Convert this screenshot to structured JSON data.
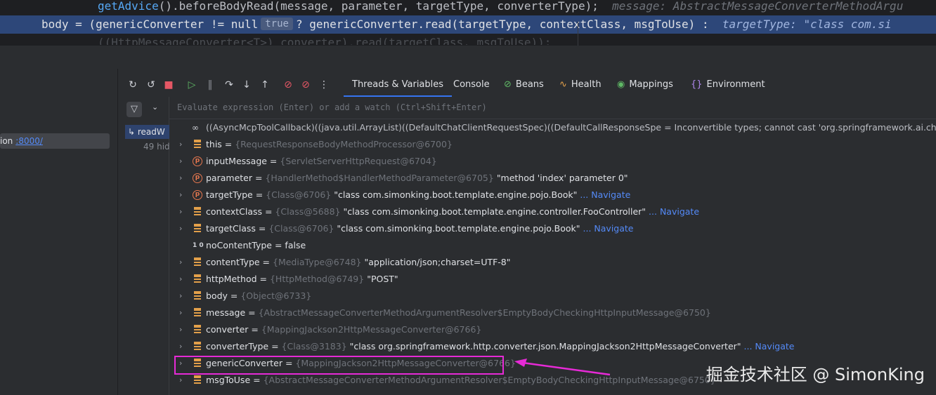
{
  "editor": {
    "line1": {
      "code_fn": "getAdvice",
      "code_rest": "().beforeBodyRead(message, parameter, targetType, converterType);",
      "hint": "message: AbstractMessageConverterMethodArgu"
    },
    "line2": {
      "code_a": "body = (genericConverter != null",
      "inline_value": "true",
      "code_b": "? genericConverter.read(targetType, contextClass, msgToUse) :",
      "hint": "targetType: \"class com.si"
    },
    "line3": {
      "code": "((HttpMessageConverter<T>) converter).read(targetClass, msgToUse));"
    }
  },
  "services": {
    "item_prefix": "ion",
    "item_port": ":8000/"
  },
  "toolbar": {
    "tabs": [
      {
        "label": "Threads & Variables",
        "active": true
      },
      {
        "label": "Console",
        "active": false
      },
      {
        "label": "Beans",
        "icon": "beans-icon",
        "active": false
      },
      {
        "label": "Health",
        "icon": "health-icon",
        "active": false
      },
      {
        "label": "Mappings",
        "icon": "mappings-icon",
        "active": false
      },
      {
        "label": "Environment",
        "icon": "environment-icon",
        "active": false
      }
    ]
  },
  "frames": {
    "current": "readW",
    "hidden": "49 hid"
  },
  "eval": {
    "placeholder": "Evaluate expression (Enter) or add a watch (Ctrl+Shift+Enter)"
  },
  "variables": [
    {
      "kind": "watch",
      "expandable": false,
      "name": "",
      "text": "((AsyncMcpToolCallback)((java.util.ArrayList)((DefaultChatClientRequestSpec)((DefaultCallResponseSpe = Inconvertible types; cannot cast 'org.springframework.ai.chat.client.ChatCli"
    },
    {
      "kind": "field",
      "expandable": true,
      "name": "this",
      "type": "{RequestResponseBodyMethodProcessor@6700}",
      "value": "",
      "navigate": ""
    },
    {
      "kind": "param",
      "expandable": true,
      "name": "inputMessage",
      "type": "{ServletServerHttpRequest@6704}",
      "value": "",
      "navigate": ""
    },
    {
      "kind": "param",
      "expandable": true,
      "name": "parameter",
      "type": "{HandlerMethod$HandlerMethodParameter@6705}",
      "value": "\"method 'index' parameter 0\"",
      "navigate": ""
    },
    {
      "kind": "param",
      "expandable": true,
      "name": "targetType",
      "type": "{Class@6706}",
      "value": "\"class com.simonking.boot.template.engine.pojo.Book\"",
      "navigate": "... Navigate"
    },
    {
      "kind": "field",
      "expandable": true,
      "name": "contextClass",
      "type": "{Class@5688}",
      "value": "\"class com.simonking.boot.template.engine.controller.FooController\"",
      "navigate": "... Navigate"
    },
    {
      "kind": "field",
      "expandable": true,
      "name": "targetClass",
      "type": "{Class@6706}",
      "value": "\"class com.simonking.boot.template.engine.pojo.Book\"",
      "navigate": "... Navigate"
    },
    {
      "kind": "prim",
      "expandable": false,
      "name": "noContentType",
      "type": "",
      "value": "false",
      "navigate": ""
    },
    {
      "kind": "field",
      "expandable": true,
      "name": "contentType",
      "type": "{MediaType@6748}",
      "value": "\"application/json;charset=UTF-8\"",
      "navigate": ""
    },
    {
      "kind": "field",
      "expandable": true,
      "name": "httpMethod",
      "type": "{HttpMethod@6749}",
      "value": "\"POST\"",
      "navigate": ""
    },
    {
      "kind": "field",
      "expandable": true,
      "name": "body",
      "type": "{Object@6733}",
      "value": "",
      "navigate": ""
    },
    {
      "kind": "field",
      "expandable": true,
      "name": "message",
      "type": "{AbstractMessageConverterMethodArgumentResolver$EmptyBodyCheckingHttpInputMessage@6750}",
      "value": "",
      "navigate": ""
    },
    {
      "kind": "field",
      "expandable": true,
      "name": "converter",
      "type": "{MappingJackson2HttpMessageConverter@6766}",
      "value": "",
      "navigate": ""
    },
    {
      "kind": "field",
      "expandable": true,
      "name": "converterType",
      "type": "{Class@3183}",
      "value": "\"class org.springframework.http.converter.json.MappingJackson2HttpMessageConverter\"",
      "navigate": "... Navigate"
    },
    {
      "kind": "field",
      "expandable": true,
      "name": "genericConverter",
      "type": "{MappingJackson2HttpMessageConverter@6766}",
      "value": "",
      "navigate": ""
    },
    {
      "kind": "field",
      "expandable": true,
      "name": "msgToUse",
      "type": "{AbstractMessageConverterMethodArgumentResolver$EmptyBodyCheckingHttpInputMessage@6750}",
      "value": "",
      "navigate": ""
    }
  ],
  "watermark": "掘金技术社区 @ SimonKing",
  "colors": {
    "accent": "#3574f0",
    "highlight": "#e62ad6",
    "navigate": "#548af7"
  }
}
